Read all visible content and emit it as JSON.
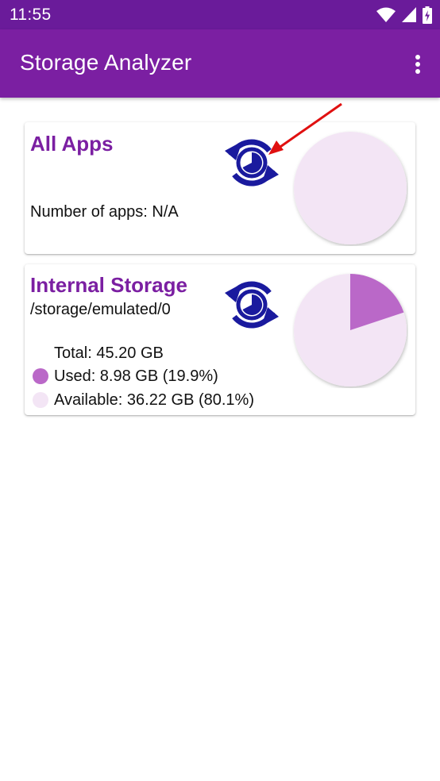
{
  "status_bar": {
    "time": "11:55",
    "icons": [
      "wifi-icon",
      "cellular-signal-icon",
      "battery-charging-icon"
    ]
  },
  "app_bar": {
    "title": "Storage Analyzer",
    "menu_icon": "more-vert-icon"
  },
  "all_apps_card": {
    "title": "All Apps",
    "number_of_apps": "Number of apps: N/A",
    "refresh_icon": "refresh-pie-icon",
    "pie": {
      "used_fraction": 0.0
    }
  },
  "internal_storage_card": {
    "title": "Internal Storage",
    "path": "/storage/emulated/0",
    "total": "Total: 45.20 GB",
    "used": "Used: 8.98 GB (19.9%)",
    "available": "Available: 36.22 GB (80.1%)",
    "refresh_icon": "refresh-pie-icon",
    "pie": {
      "used_fraction": 0.199
    }
  },
  "colors": {
    "status_bar": "#6a1b9a",
    "app_bar": "#7b1fa2",
    "title_purple": "#7b1fa2",
    "used": "#ba68c8",
    "available": "#f3e5f5",
    "icon_blue": "#1a1a9e",
    "annotation_arrow": "#e01010"
  }
}
